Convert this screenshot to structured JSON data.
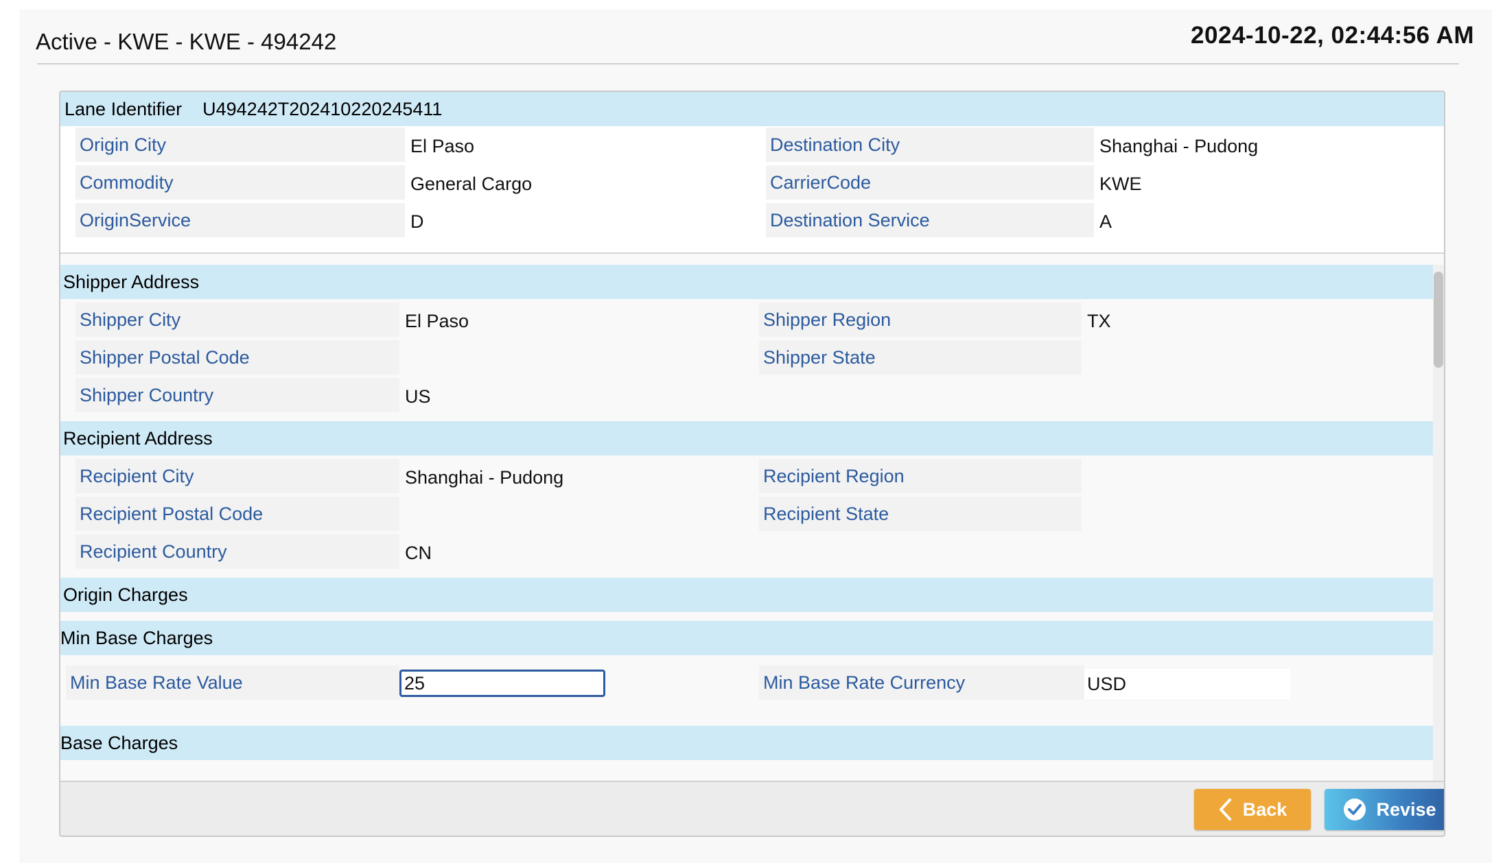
{
  "header": {
    "title": "Active - KWE - KWE - 494242",
    "timestamp": "2024-10-22, 02:44:56 AM"
  },
  "lane": {
    "identifier_label": "Lane Identifier",
    "identifier_value": "U494242T20241022024541​1",
    "fields": {
      "origin_city_label": "Origin City",
      "origin_city_value": "El Paso",
      "destination_city_label": "Destination City",
      "destination_city_value": "Shanghai - Pudong",
      "commodity_label": "Commodity",
      "commodity_value": "General Cargo",
      "carrier_code_label": "CarrierCode",
      "carrier_code_value": "KWE",
      "origin_service_label": "OriginService",
      "origin_service_value": "D",
      "destination_service_label": "Destination Service",
      "destination_service_value": "A"
    }
  },
  "shipper": {
    "heading": "Shipper Address",
    "city_label": "Shipper City",
    "city_value": "El Paso",
    "region_label": "Shipper Region",
    "region_value": "TX",
    "postal_label": "Shipper Postal Code",
    "postal_value": "",
    "state_label": "Shipper State",
    "state_value": "",
    "country_label": "Shipper Country",
    "country_value": "US"
  },
  "recipient": {
    "heading": "Recipient Address",
    "city_label": "Recipient City",
    "city_value": "Shanghai - Pudong",
    "region_label": "Recipient Region",
    "region_value": "",
    "postal_label": "Recipient Postal Code",
    "postal_value": "",
    "state_label": "Recipient State",
    "state_value": "",
    "country_label": "Recipient Country",
    "country_value": "CN"
  },
  "charges": {
    "origin_heading": "Origin Charges",
    "min_base_heading": "Min Base Charges",
    "min_base_rate_value_label": "Min Base Rate Value",
    "min_base_rate_value": "25",
    "min_base_rate_currency_label": "Min Base Rate Currency",
    "min_base_rate_currency": "USD",
    "base_heading": "Base Charges"
  },
  "footer": {
    "back_label": "Back",
    "revise_label": "Revise"
  },
  "colors": {
    "section_bg": "#cfeaf7",
    "label_blue": "#2b5a9e",
    "back_orange": "#f0a739",
    "revise_blue": "#3a7fc1"
  },
  "icons": {
    "back": "chevron-left-icon",
    "revise": "check-circle-icon"
  }
}
